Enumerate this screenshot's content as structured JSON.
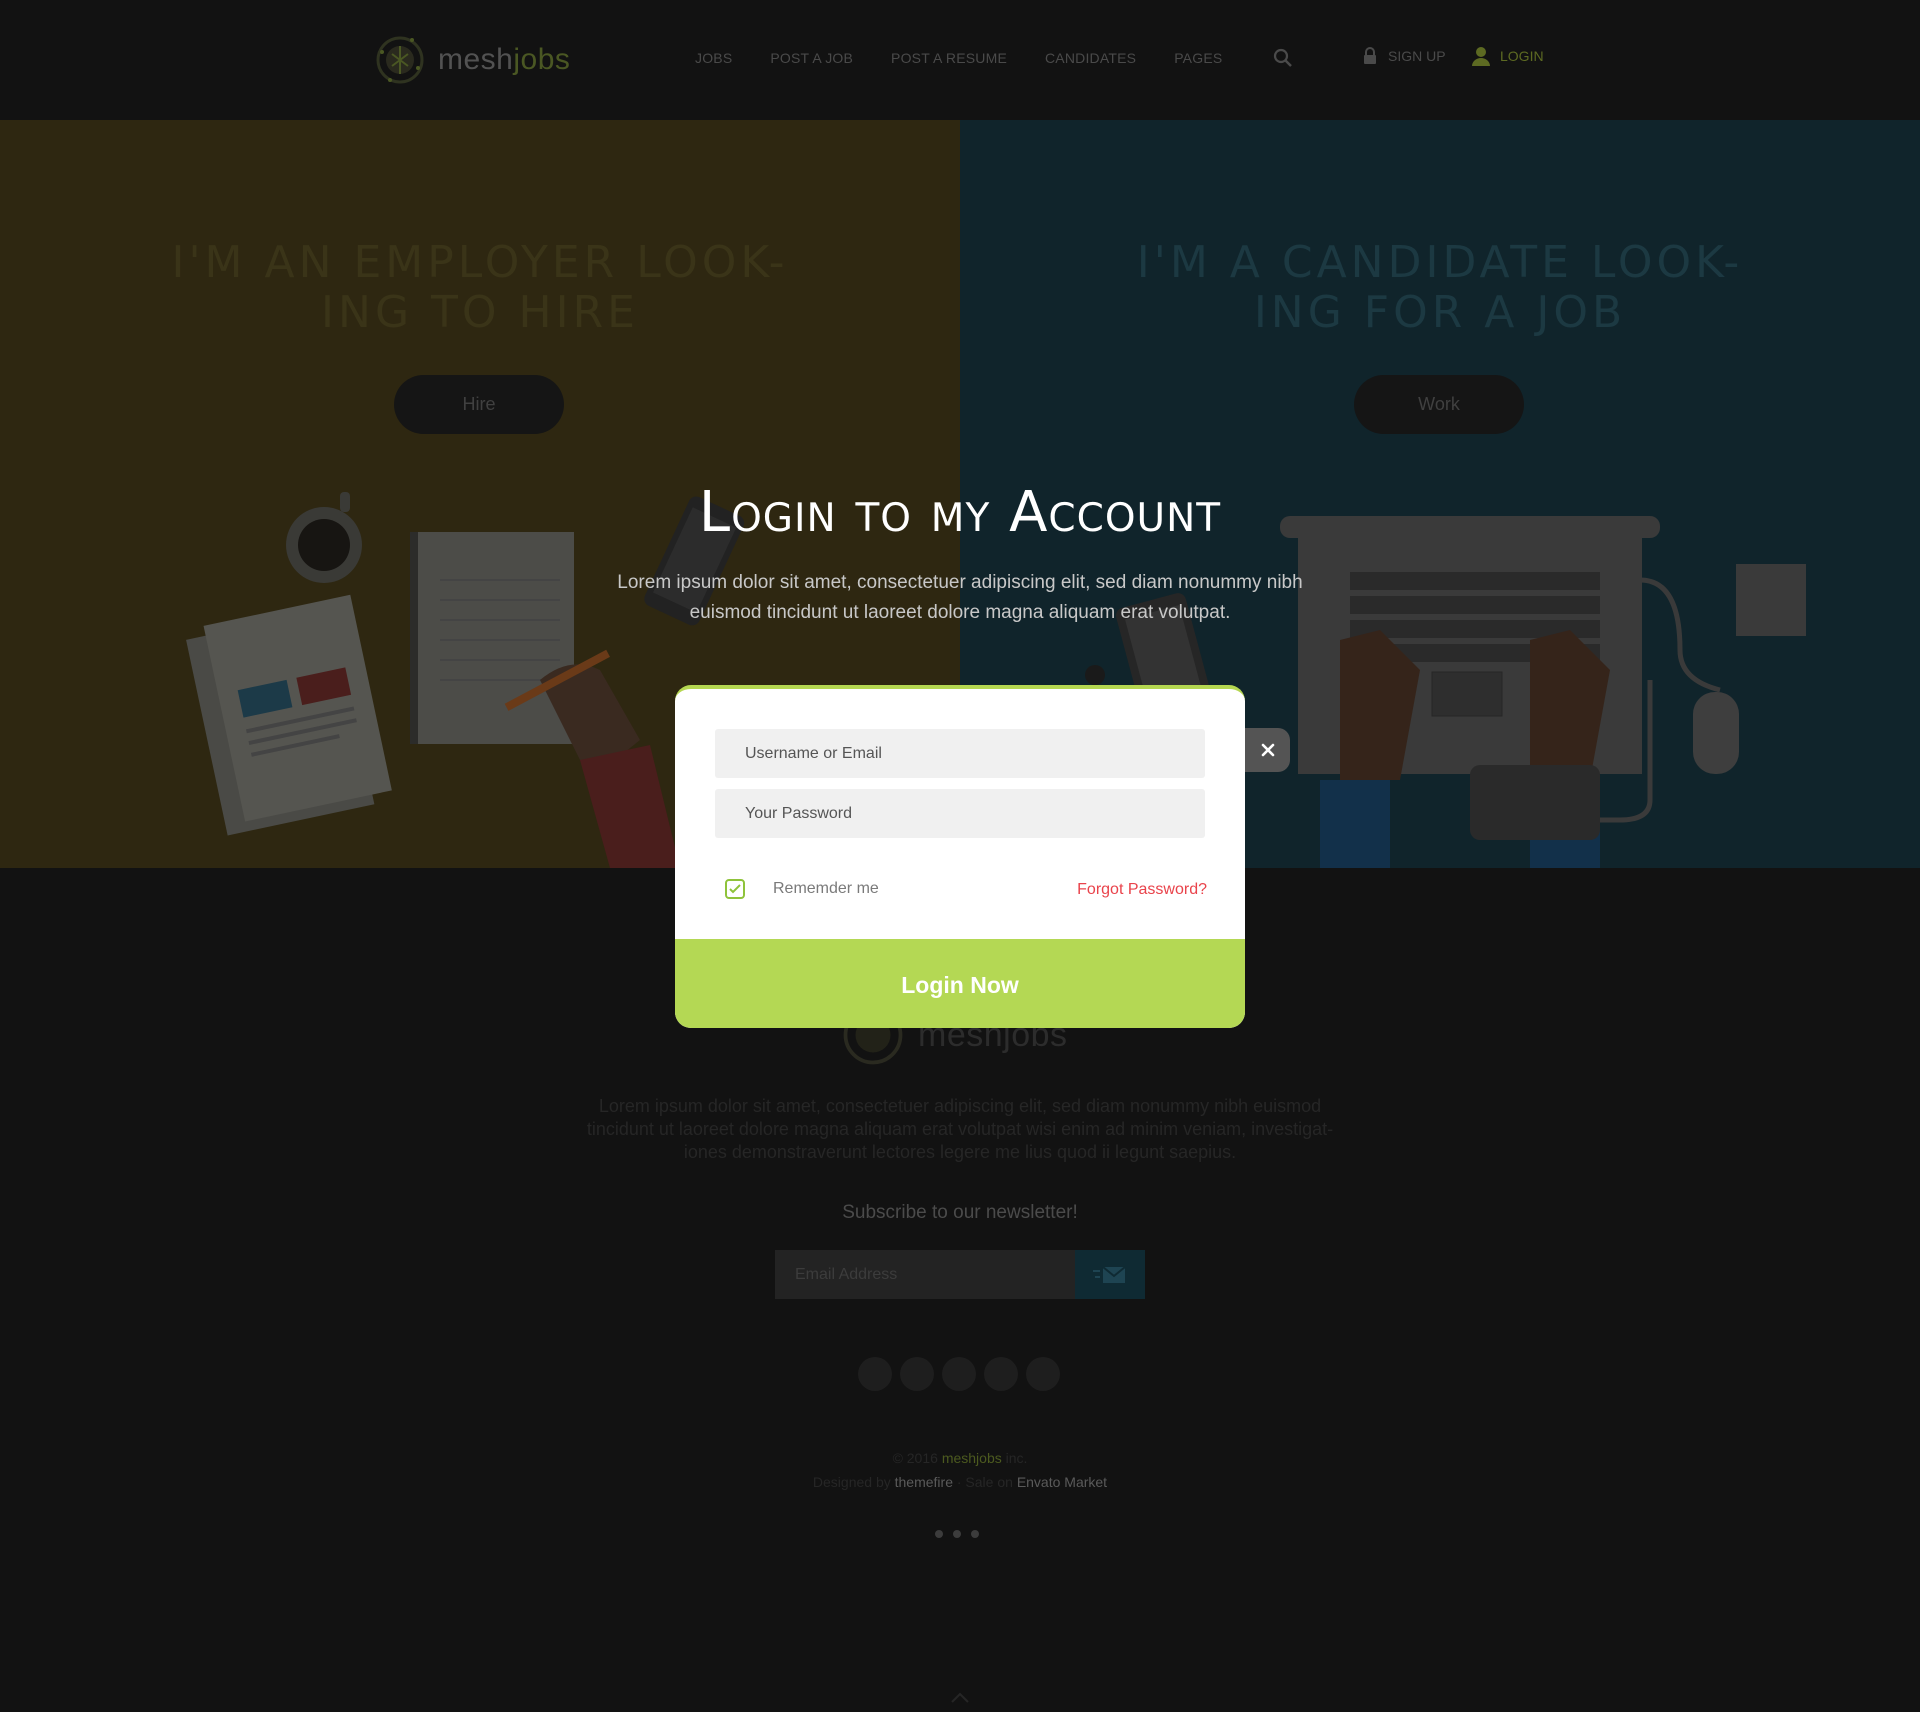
{
  "brand": {
    "name_prefix": "mesh",
    "name_suffix": "jobs"
  },
  "nav": {
    "items": [
      "JOBS",
      "POST A JOB",
      "POST A RESUME",
      "CANDIDATES",
      "PAGES"
    ],
    "signup_label": "SIGN UP",
    "login_label": "LOGIN"
  },
  "hero": {
    "employer": {
      "title_line1": "I'M AN EMPLOYER LOOK-",
      "title_line2": "ING TO HIRE",
      "button": "Hire"
    },
    "candidate": {
      "title_line1": "I'M A CANDIDATE LOOK-",
      "title_line2": "ING FOR A JOB",
      "button": "Work"
    }
  },
  "login_modal": {
    "title": "Login to my Account",
    "description": "Lorem ipsum dolor sit amet, consectetuer adipiscing elit, sed diam nonummy nibh euismod tincidunt ut laoreet dolore magna aliquam erat volutpat.",
    "username_placeholder": "Username or Email",
    "password_placeholder": "Your Password",
    "remember_label": "Rememder me",
    "remember_checked": true,
    "forgot_label": "Forgot Password?",
    "submit_label": "Login Now"
  },
  "footer": {
    "description": "Lorem ipsum dolor sit amet, consectetuer adipiscing elit, sed diam nonummy nibh euismod tincidunt ut laoreet dolore magna aliquam erat volutpat wisi enim ad minim veniam, investigat- iones demonstraverunt lectores legere me lius quod ii legunt saepius.",
    "newsletter_title": "Subscribe to our newsletter!",
    "email_placeholder": "Email Address",
    "copyright_pre": "© 2016 ",
    "copyright_brand": "meshjobs",
    "copyright_post": " inc.",
    "credit_pre": "Designed by ",
    "credit_designer": "themefire",
    "credit_mid": " · Sale on ",
    "credit_market": "Envato Market"
  },
  "colors": {
    "accent_green": "#b4d854",
    "forgot_red": "#e9434b",
    "employer_panel": "#2e2711",
    "candidate_panel": "#10242b"
  },
  "icons": [
    "search-icon",
    "lock-icon",
    "user-icon",
    "check-icon",
    "close-icon",
    "send-mail-icon",
    "chevron-up-icon"
  ]
}
